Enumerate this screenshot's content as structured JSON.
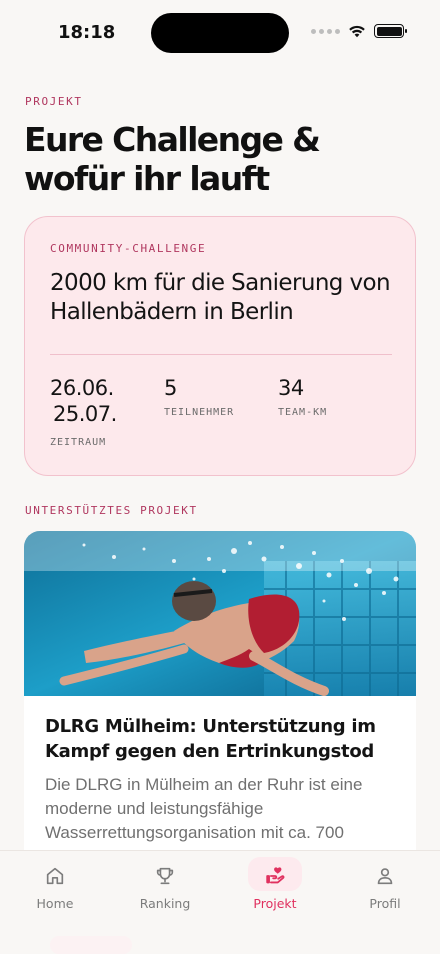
{
  "status_bar": {
    "time": "18:18"
  },
  "header": {
    "eyebrow": "PROJEKT",
    "title": "Eure Challenge & wofür ihr lauft"
  },
  "challenge": {
    "label": "COMMUNITY-CHALLENGE",
    "title": "2000 km für die Sanierung von Hallenbädern in Berlin",
    "period_start": "26.06.",
    "period_end": "25.07.",
    "period_label": "ZEITRAUM",
    "members_value": "5",
    "members_label": "TEILNEHMER",
    "km_value": "34",
    "km_label": "TEAM-KM"
  },
  "project": {
    "eyebrow": "UNTERSTÜTZTES PROJEKT",
    "title": "DLRG Mülheim: Unterstützung im Kampf gegen den Ertrinkungstod",
    "text": "Die DLRG in Mülheim an der Ruhr ist eine moderne und leistungsfähige Wasserrettungsorganisation mit ca. 700"
  },
  "tabs": [
    {
      "label": "Home",
      "icon": "home-icon"
    },
    {
      "label": "Ranking",
      "icon": "trophy-icon"
    },
    {
      "label": "Projekt",
      "icon": "hand-heart-icon",
      "active": true
    },
    {
      "label": "Profil",
      "icon": "person-icon"
    }
  ],
  "colors": {
    "accent": "#e0315f",
    "eyebrow": "#b0375f",
    "card_bg": "#fde9ec",
    "card_border": "#f2c2cd",
    "page_bg": "#f9f7f5"
  }
}
